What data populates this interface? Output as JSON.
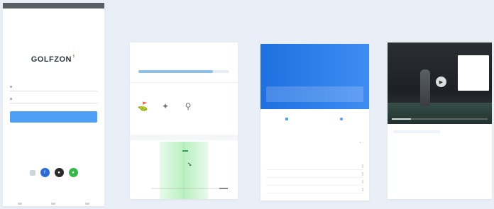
{
  "colors": {
    "background": "#e9eef7",
    "primary_blue": "#4da0f5",
    "header_blue": "#1e6fe0",
    "green_area": "#b9f0c0",
    "accent_red": "#e0463d"
  },
  "login": {
    "logo": "GOLFZON",
    "language": "",
    "username_placeholder": "",
    "password_placeholder": "",
    "login_button": "",
    "links": "",
    "other_login_label": "",
    "social_icons": [
      "settings-icon",
      "facebook-icon",
      "apple-icon",
      "wechat-icon"
    ]
  },
  "stats": {
    "columns": [
      {
        "value": "",
        "label": ""
      },
      {
        "value": "",
        "label": ""
      },
      {
        "value": "",
        "label": ""
      }
    ],
    "progress_fraction": 0.82,
    "progress_left": "",
    "progress_right": "",
    "section_title": "",
    "tools": [
      {
        "icon": "club-icon",
        "label": ""
      },
      {
        "icon": "swing-icon",
        "label": ""
      },
      {
        "icon": "tee-icon",
        "label": ""
      }
    ],
    "chart_header": ""
  },
  "header_card": {
    "line1": "",
    "title": "",
    "subtitle": "",
    "pills": [
      "",
      "",
      ""
    ],
    "tabs": [
      "",
      ""
    ],
    "row_label": "",
    "row_value": "",
    "row_delta": "",
    "list_header": "",
    "list_rows": [
      {
        "name": "",
        "value": ""
      },
      {
        "name": "",
        "value": ""
      },
      {
        "name": "",
        "value": ""
      },
      {
        "name": "",
        "value": ""
      }
    ]
  },
  "video_card": {
    "video_title": "",
    "panel_lines": [
      "",
      "",
      ""
    ],
    "seg": [
      "",
      ""
    ],
    "table": [
      {
        "k": "",
        "a": "",
        "b": "",
        "c": ""
      },
      {
        "k": "",
        "a": "",
        "b": "",
        "c": ""
      },
      {
        "k": "",
        "a": "",
        "b": "",
        "c": ""
      },
      {
        "k": "",
        "a": "",
        "b": "",
        "c": ""
      }
    ]
  }
}
